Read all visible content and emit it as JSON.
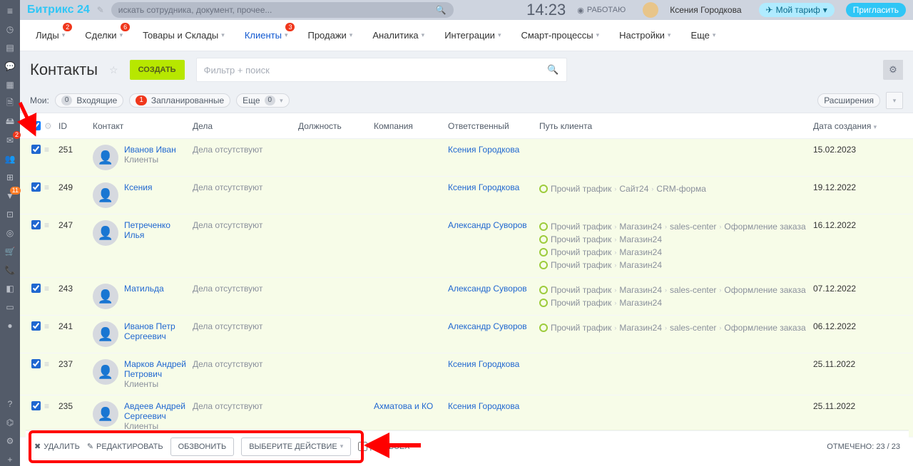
{
  "brand": {
    "part1": "Битрикс",
    "part2": "24"
  },
  "search": {
    "placeholder": "искать сотрудника, документ, прочее..."
  },
  "clock": "14:23",
  "work_status": "РАБОТАЮ",
  "user_name": "Ксения Городкова",
  "tariff_label": "Мой тариф",
  "invite_label": "Пригласить",
  "nav": [
    {
      "label": "Лиды",
      "badge": "2",
      "chev": true
    },
    {
      "label": "Сделки",
      "badge": "6",
      "chev": true
    },
    {
      "label": "Товары и Склады",
      "chev": true
    },
    {
      "label": "Клиенты",
      "badge": "3",
      "chev": true,
      "active": true
    },
    {
      "label": "Продажи",
      "chev": true
    },
    {
      "label": "Аналитика",
      "chev": true
    },
    {
      "label": "Интеграции",
      "chev": true
    },
    {
      "label": "Смарт-процессы",
      "chev": true
    },
    {
      "label": "Настройки",
      "chev": true
    },
    {
      "label": "Еще",
      "chev": true
    }
  ],
  "page_title": "Контакты",
  "create_btn": "СОЗДАТЬ",
  "filter_placeholder": "Фильтр + поиск",
  "chipsrow": {
    "mine": "Мои:",
    "incoming": "Входящие",
    "incoming_count": "0",
    "planned": "Запланированные",
    "planned_count": "1",
    "more": "Еще",
    "more_count": "0",
    "extensions": "Расширения"
  },
  "columns": {
    "id": "ID",
    "contact": "Контакт",
    "deals": "Дела",
    "position": "Должность",
    "company": "Компания",
    "responsible": "Ответственный",
    "path": "Путь клиента",
    "date": "Дата создания"
  },
  "deals_none": "Дела отсутствуют",
  "rows": [
    {
      "id": "251",
      "name": "Иванов Иван",
      "sub": "Клиенты",
      "company": "",
      "resp": "Ксения Городкова",
      "path": [],
      "date": "15.02.2023"
    },
    {
      "id": "249",
      "name": "Ксения",
      "sub": "",
      "company": "",
      "resp": "Ксения Городкова",
      "path": [
        [
          "Прочий трафик",
          "Сайт24",
          "CRM-форма"
        ]
      ],
      "date": "19.12.2022"
    },
    {
      "id": "247",
      "name": "Петреченко Илья",
      "sub": "",
      "company": "",
      "resp": "Александр Суворов",
      "path": [
        [
          "Прочий трафик",
          "Магазин24",
          "sales-center",
          "Оформление заказа"
        ],
        [
          "Прочий трафик",
          "Магазин24"
        ],
        [
          "Прочий трафик",
          "Магазин24"
        ],
        [
          "Прочий трафик",
          "Магазин24"
        ]
      ],
      "date": "16.12.2022"
    },
    {
      "id": "243",
      "name": "Матильда",
      "sub": "",
      "company": "",
      "resp": "Александр Суворов",
      "path": [
        [
          "Прочий трафик",
          "Магазин24",
          "sales-center",
          "Оформление заказа"
        ],
        [
          "Прочий трафик",
          "Магазин24"
        ]
      ],
      "date": "07.12.2022"
    },
    {
      "id": "241",
      "name": "Иванов Петр Сергеевич",
      "sub": "",
      "company": "",
      "resp": "Александр Суворов",
      "path": [
        [
          "Прочий трафик",
          "Магазин24",
          "sales-center",
          "Оформление заказа"
        ]
      ],
      "date": "06.12.2022"
    },
    {
      "id": "237",
      "name": "Марков Андрей Петрович",
      "sub": "Клиенты",
      "company": "",
      "resp": "Ксения Городкова",
      "path": [],
      "date": "25.11.2022"
    },
    {
      "id": "235",
      "name": "Авдеев Андрей Сергеевич",
      "sub": "Клиенты",
      "company": "Ахматова и КО",
      "resp": "Ксения Городкова",
      "path": [],
      "date": "25.11.2022"
    }
  ],
  "actionbar": {
    "delete": "УДАЛИТЬ",
    "edit": "РЕДАКТИРОВАТЬ",
    "call": "ОБЗВОНИТЬ",
    "choose": "ВЫБЕРИТЕ ДЕЙСТВИЕ",
    "for_all": "ДЛЯ ВСЕХ",
    "selected": "ОТМЕЧЕНО: 23 / 23"
  }
}
